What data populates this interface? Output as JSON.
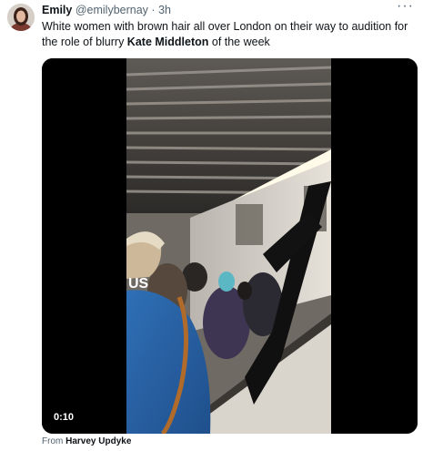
{
  "tweet": {
    "author_name": "Emily",
    "author_handle": "@emilybernay",
    "separator": "·",
    "timestamp": "3h",
    "more_glyph": "···",
    "text_before": "White women with brown hair all over London on their way to audition for the role of blurry ",
    "text_bold": "Kate Middleton",
    "text_after": " of the week"
  },
  "media": {
    "duration": "0:10",
    "jersey_text": "US"
  },
  "attribution": {
    "prefix": "From",
    "source": "Harvey Updyke"
  }
}
